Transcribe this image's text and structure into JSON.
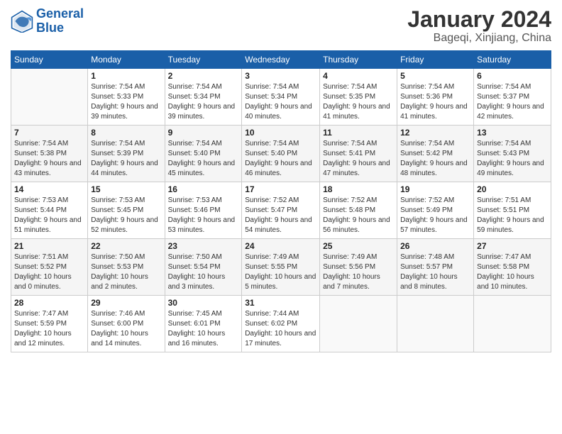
{
  "header": {
    "logo_line1": "General",
    "logo_line2": "Blue",
    "month_title": "January 2024",
    "location": "Bageqi, Xinjiang, China"
  },
  "weekdays": [
    "Sunday",
    "Monday",
    "Tuesday",
    "Wednesday",
    "Thursday",
    "Friday",
    "Saturday"
  ],
  "weeks": [
    [
      {
        "day": "",
        "sunrise": "",
        "sunset": "",
        "daylight": ""
      },
      {
        "day": "1",
        "sunrise": "Sunrise: 7:54 AM",
        "sunset": "Sunset: 5:33 PM",
        "daylight": "Daylight: 9 hours and 39 minutes."
      },
      {
        "day": "2",
        "sunrise": "Sunrise: 7:54 AM",
        "sunset": "Sunset: 5:34 PM",
        "daylight": "Daylight: 9 hours and 39 minutes."
      },
      {
        "day": "3",
        "sunrise": "Sunrise: 7:54 AM",
        "sunset": "Sunset: 5:34 PM",
        "daylight": "Daylight: 9 hours and 40 minutes."
      },
      {
        "day": "4",
        "sunrise": "Sunrise: 7:54 AM",
        "sunset": "Sunset: 5:35 PM",
        "daylight": "Daylight: 9 hours and 41 minutes."
      },
      {
        "day": "5",
        "sunrise": "Sunrise: 7:54 AM",
        "sunset": "Sunset: 5:36 PM",
        "daylight": "Daylight: 9 hours and 41 minutes."
      },
      {
        "day": "6",
        "sunrise": "Sunrise: 7:54 AM",
        "sunset": "Sunset: 5:37 PM",
        "daylight": "Daylight: 9 hours and 42 minutes."
      }
    ],
    [
      {
        "day": "7",
        "sunrise": "Sunrise: 7:54 AM",
        "sunset": "Sunset: 5:38 PM",
        "daylight": "Daylight: 9 hours and 43 minutes."
      },
      {
        "day": "8",
        "sunrise": "Sunrise: 7:54 AM",
        "sunset": "Sunset: 5:39 PM",
        "daylight": "Daylight: 9 hours and 44 minutes."
      },
      {
        "day": "9",
        "sunrise": "Sunrise: 7:54 AM",
        "sunset": "Sunset: 5:40 PM",
        "daylight": "Daylight: 9 hours and 45 minutes."
      },
      {
        "day": "10",
        "sunrise": "Sunrise: 7:54 AM",
        "sunset": "Sunset: 5:40 PM",
        "daylight": "Daylight: 9 hours and 46 minutes."
      },
      {
        "day": "11",
        "sunrise": "Sunrise: 7:54 AM",
        "sunset": "Sunset: 5:41 PM",
        "daylight": "Daylight: 9 hours and 47 minutes."
      },
      {
        "day": "12",
        "sunrise": "Sunrise: 7:54 AM",
        "sunset": "Sunset: 5:42 PM",
        "daylight": "Daylight: 9 hours and 48 minutes."
      },
      {
        "day": "13",
        "sunrise": "Sunrise: 7:54 AM",
        "sunset": "Sunset: 5:43 PM",
        "daylight": "Daylight: 9 hours and 49 minutes."
      }
    ],
    [
      {
        "day": "14",
        "sunrise": "Sunrise: 7:53 AM",
        "sunset": "Sunset: 5:44 PM",
        "daylight": "Daylight: 9 hours and 51 minutes."
      },
      {
        "day": "15",
        "sunrise": "Sunrise: 7:53 AM",
        "sunset": "Sunset: 5:45 PM",
        "daylight": "Daylight: 9 hours and 52 minutes."
      },
      {
        "day": "16",
        "sunrise": "Sunrise: 7:53 AM",
        "sunset": "Sunset: 5:46 PM",
        "daylight": "Daylight: 9 hours and 53 minutes."
      },
      {
        "day": "17",
        "sunrise": "Sunrise: 7:52 AM",
        "sunset": "Sunset: 5:47 PM",
        "daylight": "Daylight: 9 hours and 54 minutes."
      },
      {
        "day": "18",
        "sunrise": "Sunrise: 7:52 AM",
        "sunset": "Sunset: 5:48 PM",
        "daylight": "Daylight: 9 hours and 56 minutes."
      },
      {
        "day": "19",
        "sunrise": "Sunrise: 7:52 AM",
        "sunset": "Sunset: 5:49 PM",
        "daylight": "Daylight: 9 hours and 57 minutes."
      },
      {
        "day": "20",
        "sunrise": "Sunrise: 7:51 AM",
        "sunset": "Sunset: 5:51 PM",
        "daylight": "Daylight: 9 hours and 59 minutes."
      }
    ],
    [
      {
        "day": "21",
        "sunrise": "Sunrise: 7:51 AM",
        "sunset": "Sunset: 5:52 PM",
        "daylight": "Daylight: 10 hours and 0 minutes."
      },
      {
        "day": "22",
        "sunrise": "Sunrise: 7:50 AM",
        "sunset": "Sunset: 5:53 PM",
        "daylight": "Daylight: 10 hours and 2 minutes."
      },
      {
        "day": "23",
        "sunrise": "Sunrise: 7:50 AM",
        "sunset": "Sunset: 5:54 PM",
        "daylight": "Daylight: 10 hours and 3 minutes."
      },
      {
        "day": "24",
        "sunrise": "Sunrise: 7:49 AM",
        "sunset": "Sunset: 5:55 PM",
        "daylight": "Daylight: 10 hours and 5 minutes."
      },
      {
        "day": "25",
        "sunrise": "Sunrise: 7:49 AM",
        "sunset": "Sunset: 5:56 PM",
        "daylight": "Daylight: 10 hours and 7 minutes."
      },
      {
        "day": "26",
        "sunrise": "Sunrise: 7:48 AM",
        "sunset": "Sunset: 5:57 PM",
        "daylight": "Daylight: 10 hours and 8 minutes."
      },
      {
        "day": "27",
        "sunrise": "Sunrise: 7:47 AM",
        "sunset": "Sunset: 5:58 PM",
        "daylight": "Daylight: 10 hours and 10 minutes."
      }
    ],
    [
      {
        "day": "28",
        "sunrise": "Sunrise: 7:47 AM",
        "sunset": "Sunset: 5:59 PM",
        "daylight": "Daylight: 10 hours and 12 minutes."
      },
      {
        "day": "29",
        "sunrise": "Sunrise: 7:46 AM",
        "sunset": "Sunset: 6:00 PM",
        "daylight": "Daylight: 10 hours and 14 minutes."
      },
      {
        "day": "30",
        "sunrise": "Sunrise: 7:45 AM",
        "sunset": "Sunset: 6:01 PM",
        "daylight": "Daylight: 10 hours and 16 minutes."
      },
      {
        "day": "31",
        "sunrise": "Sunrise: 7:44 AM",
        "sunset": "Sunset: 6:02 PM",
        "daylight": "Daylight: 10 hours and 17 minutes."
      },
      {
        "day": "",
        "sunrise": "",
        "sunset": "",
        "daylight": ""
      },
      {
        "day": "",
        "sunrise": "",
        "sunset": "",
        "daylight": ""
      },
      {
        "day": "",
        "sunrise": "",
        "sunset": "",
        "daylight": ""
      }
    ]
  ]
}
